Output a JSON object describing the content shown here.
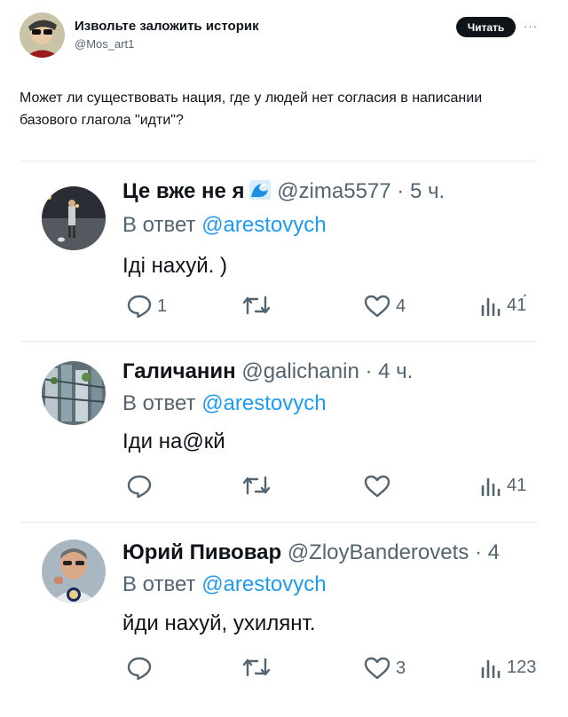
{
  "main": {
    "author_name": "Извольте заложить историк",
    "author_handle": "@Mos_art1",
    "follow_label": "Читать",
    "more_label": "···",
    "text": "Может ли существовать нация, где у людей нет согласия в написании базового глагола \"идти\"?"
  },
  "replies": [
    {
      "name": "Це вже не я",
      "handle": "@zima5577",
      "dot": "·",
      "time": "5 ч.",
      "in_reply_prefix": "В ответ",
      "mention": "@arestovych",
      "text": "Іді нахуй. )",
      "replies_count": "1",
      "retweets_count": "",
      "likes_count": "4",
      "views_count": "41́"
    },
    {
      "name": "Галичанин",
      "handle": "@galichanin",
      "dot": "·",
      "time": "4 ч.",
      "in_reply_prefix": "В ответ",
      "mention": "@arestovych",
      "text": "Іди на@кй",
      "replies_count": "",
      "retweets_count": "",
      "likes_count": "",
      "views_count": "41"
    },
    {
      "name": "Юрий Пивовар",
      "handle": "@ZloyBanderovets",
      "dot": "·",
      "time": "4",
      "in_reply_prefix": "В ответ",
      "mention": "@arestovych",
      "text": "йди нахуй, ухилянт.",
      "replies_count": "",
      "retweets_count": "",
      "likes_count": "3",
      "views_count": "123"
    }
  ],
  "colors": {
    "accent": "#1d9bf0",
    "muted": "#536471",
    "text": "#0f1419"
  }
}
